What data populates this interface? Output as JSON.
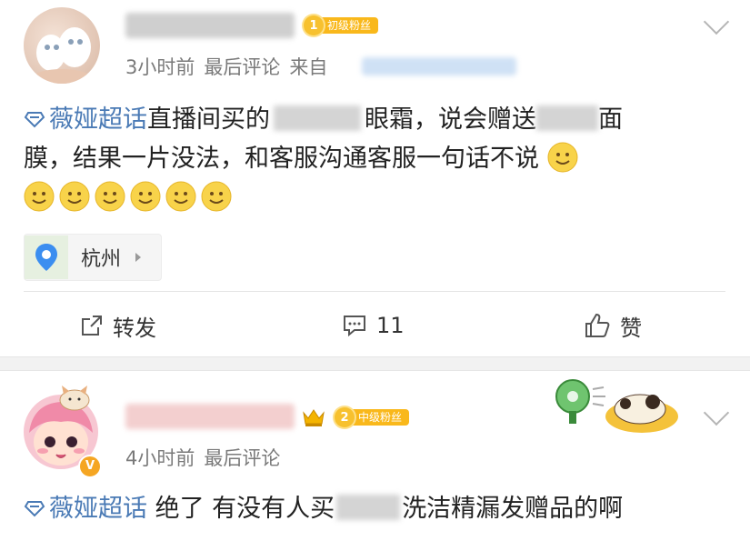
{
  "post1": {
    "badge": {
      "level": "1",
      "label": "初级粉丝"
    },
    "time": "3小时前",
    "meta_label": "最后评论",
    "source_prefix": "来自",
    "topic": "薇娅超话",
    "text_parts": [
      "直播间买的",
      "眼霜，说会赠送",
      "面",
      "膜，结果一片没法，和客服沟通客服一句话不说"
    ],
    "location": "杭州",
    "actions": {
      "repost": "转发",
      "comments": "11",
      "like": "赞"
    }
  },
  "post2": {
    "badge": {
      "level": "2",
      "label": "中级粉丝"
    },
    "time": "4小时前",
    "meta_label": "最后评论",
    "topic": "薇娅超话",
    "text_parts": [
      "绝了 有没有人买",
      "洗洁精漏发赠品的啊"
    ]
  },
  "icons": [
    "diamond-topic-icon",
    "smiley-emoji-icon",
    "location-pin-icon",
    "repost-icon",
    "comment-icon",
    "like-icon",
    "chevron-down-icon",
    "crown-icon",
    "verified-v-icon"
  ],
  "colors": {
    "topic": "#4a7ab5",
    "badge": "#f9b81b",
    "meta": "#7a7a7a"
  }
}
